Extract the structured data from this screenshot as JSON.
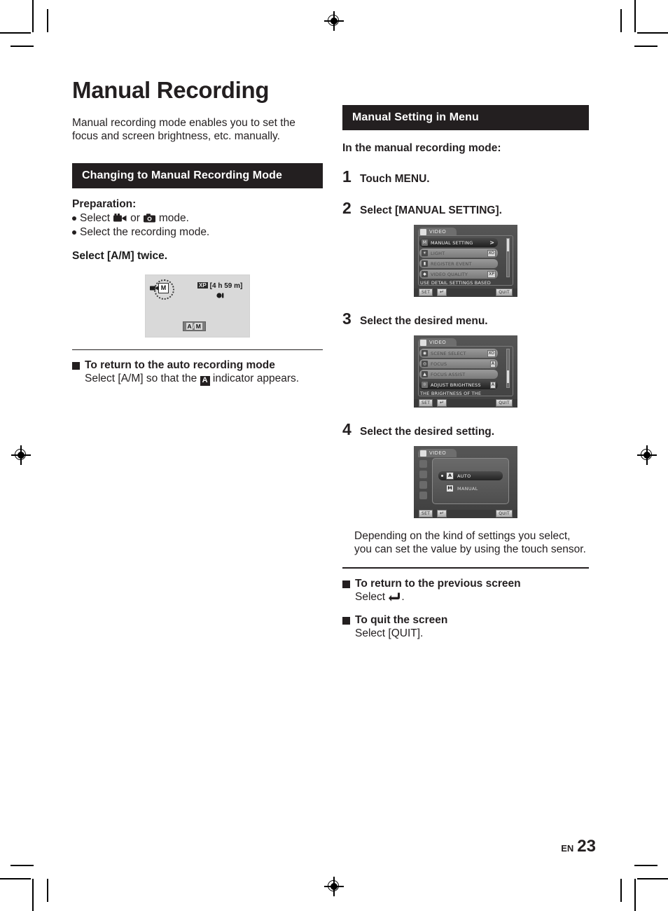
{
  "page": {
    "title": "Manual Recording",
    "intro": "Manual recording mode enables you to set the focus and screen brightness, etc. manually.",
    "footer_locale": "EN",
    "footer_page": "23"
  },
  "left": {
    "section_title": "Changing to Manual Recording Mode",
    "preparation_label": "Preparation:",
    "bullets": [
      {
        "pre": "Select",
        "icon1": "video-camera-icon",
        "mid": "or",
        "icon2": "still-camera-icon",
        "post": "mode."
      },
      {
        "text": "Select the recording mode."
      }
    ],
    "instruction": "Select [A/M] twice.",
    "lcd": {
      "mode_badge": "M",
      "camera_icon": "video-camera-icon",
      "quality_badge": "XP",
      "time_remaining": "[4 h 59 m]",
      "rec_indicator": "rec-dot-icon",
      "am_button": {
        "auto": "A",
        "sep": "/",
        "manual": "M"
      }
    },
    "return_block": {
      "heading": "To return to the auto recording mode",
      "body_pre": "Select [A/M] so that the",
      "badge": "A",
      "body_post": "indicator appears."
    }
  },
  "right": {
    "section_title": "Manual Setting in Menu",
    "lead": "In the manual recording mode:",
    "steps": [
      {
        "num": "1",
        "text": "Touch MENU."
      },
      {
        "num": "2",
        "text": "Select [MANUAL SETTING]."
      },
      {
        "num": "3",
        "text": "Select the desired menu."
      },
      {
        "num": "4",
        "text": "Select the desired setting."
      }
    ],
    "shot_step2": {
      "tab_label": "VIDEO",
      "rows": [
        {
          "label": "MANUAL SETTING",
          "value": "",
          "arrow": ">",
          "selected": true,
          "icon": "manual-setting-icon"
        },
        {
          "label": "LIGHT",
          "value": "XO",
          "arrow": "",
          "selected": false,
          "icon": "light-icon"
        },
        {
          "label": "REGISTER EVENT",
          "value": "",
          "arrow": "",
          "selected": false,
          "icon": "register-event-icon"
        },
        {
          "label": "VIDEO QUALITY",
          "value": "XP",
          "arrow": "",
          "selected": false,
          "icon": "video-quality-icon"
        }
      ],
      "description": "USE DETAIL SETTINGS BASED",
      "btn_set": "SET",
      "btn_back": "back-arrow-icon",
      "btn_quit": "QUIT"
    },
    "shot_step3": {
      "tab_label": "VIDEO",
      "rows": [
        {
          "label": "SCENE SELECT",
          "value": "XO",
          "arrow": "",
          "selected": false,
          "icon": "scene-select-icon"
        },
        {
          "label": "FOCUS",
          "value": "A",
          "arrow": "",
          "selected": false,
          "icon": "focus-icon"
        },
        {
          "label": "FOCUS ASSIST",
          "value": "",
          "arrow": "",
          "selected": false,
          "icon": "focus-assist-icon"
        },
        {
          "label": "ADJUST BRIGHTNESS",
          "value": "A",
          "arrow": "",
          "selected": true,
          "icon": "brightness-icon"
        }
      ],
      "description": "THE BRIGHTNESS OF THE",
      "btn_set": "SET",
      "btn_back": "back-arrow-icon",
      "btn_quit": "QUIT"
    },
    "shot_step4": {
      "tab_label": "VIDEO",
      "options": [
        {
          "badge": "A",
          "label": "AUTO",
          "selected": true
        },
        {
          "badge": "M",
          "label": "MANUAL",
          "selected": false
        }
      ],
      "btn_set": "SET",
      "btn_back": "back-arrow-icon",
      "btn_quit": "QUIT"
    },
    "note": "Depending on the kind of settings you select, you can set the value by using the touch sensor.",
    "previous_block": {
      "heading": "To return to the previous screen",
      "body_pre": "Select",
      "icon": "back-arrow-icon",
      "body_post": "."
    },
    "quit_block": {
      "heading": "To quit the screen",
      "body": "Select [QUIT]."
    }
  }
}
